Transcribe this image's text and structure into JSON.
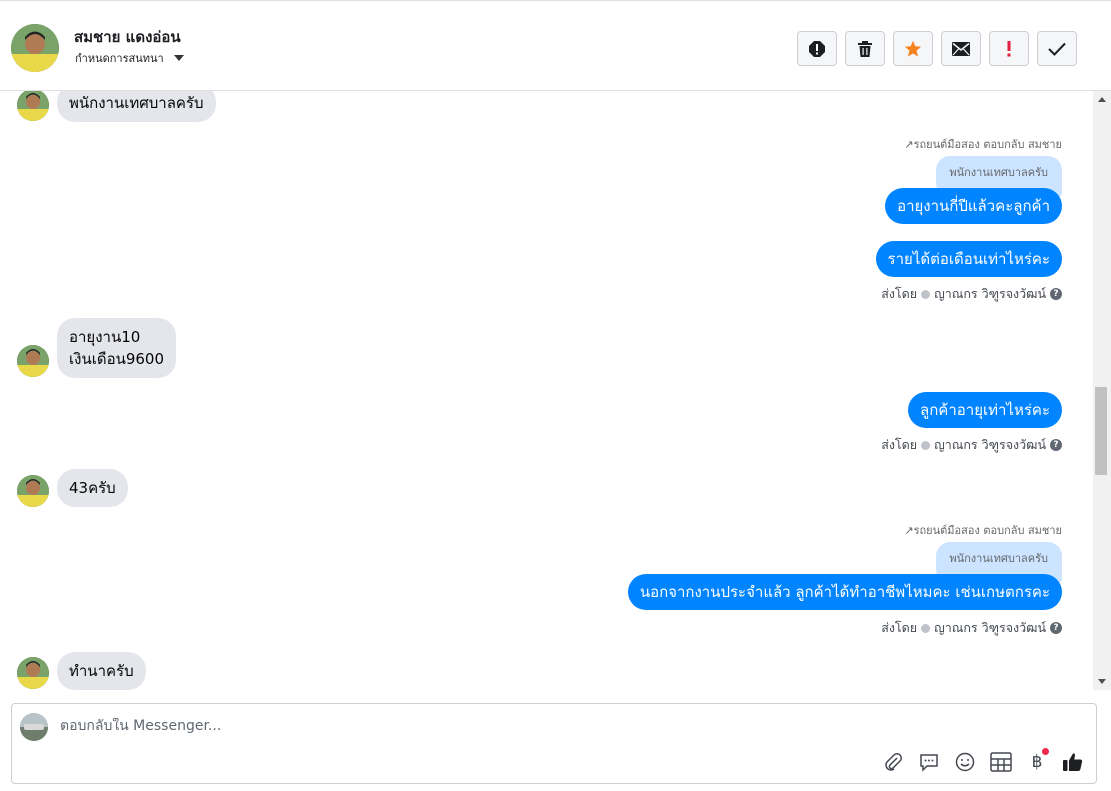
{
  "header": {
    "contact_name": "สมชาย แดงอ่อน",
    "assign_label": "กำหนดการสนทนา",
    "actions": [
      "spam-icon",
      "trash-icon",
      "star-icon",
      "mail-icon",
      "important-icon",
      "done-icon"
    ]
  },
  "colors": {
    "accent": "#0084ff",
    "star": "#f5821f",
    "important": "#e41e3f",
    "bubble_in": "#e4e6eb",
    "quote_bg": "#cce4ff"
  },
  "messages": {
    "m1_in": "พนักงานเทศบาลครับ",
    "reply_label_1": "รถยนต์มือสอง ตอบกลับ สมชาย",
    "quote_1": "พนักงานเทศบาลครับ",
    "m2_out": "อายุงานกี่ปีแล้วคะลูกค้า",
    "m3_out": "รายได้ต่อเดือนเท่าไหร่คะ",
    "sent_by_prefix": "ส่งโดย",
    "sent_by_name": "ญาณกร วิฑูรจงวัฒน์",
    "m4_in_line1": "อายุงาน10",
    "m4_in_line2": "เงินเดือน9600",
    "m5_out": "ลูกค้าอายุเท่าไหร่คะ",
    "m6_in": "43ครับ",
    "reply_label_2": "รถยนต์มือสอง ตอบกลับ สมชาย",
    "quote_2": "พนักงานเทศบาลครับ",
    "m7_out": "นอกจากงานประจำแล้ว ลูกค้าได้ทำอาชีพไหมคะ เช่นเกษตกรคะ",
    "m8_in": "ทำนาครับ"
  },
  "composer": {
    "placeholder": "ตอบกลับใน Messenger...",
    "tools": [
      "attach-icon",
      "saved-replies-icon",
      "emoji-icon",
      "table-icon",
      "baht-icon",
      "thumbs-up-icon"
    ],
    "baht_glyph": "฿"
  }
}
